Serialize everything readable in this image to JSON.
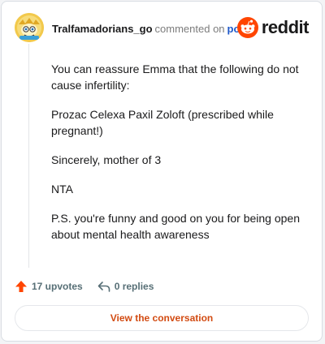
{
  "header": {
    "author": "Tralfamadorians_go",
    "action_text": "commented on",
    "post_link": "post",
    "brand_name": "reddit"
  },
  "comment": {
    "paragraphs": [
      "You can reassure Emma that the following do not cause infertility:",
      "Prozac Celexa Paxil Zoloft (prescribed while pregnant!)",
      "Sincerely, mother of 3",
      "NTA",
      "P.S. you're funny and good on you for being open about mental health awareness"
    ]
  },
  "actions": {
    "upvotes": "17 upvotes",
    "replies": "0 replies"
  },
  "cta": {
    "label": "View the conversation"
  },
  "colors": {
    "brand": "#ff4500",
    "upvote": "#ff4500",
    "link": "#1f59c9",
    "cta_text": "#d24b12"
  },
  "icons": [
    "avatar-image",
    "reddit-logo-icon",
    "upvote-arrow-icon",
    "reply-arrow-icon"
  ]
}
